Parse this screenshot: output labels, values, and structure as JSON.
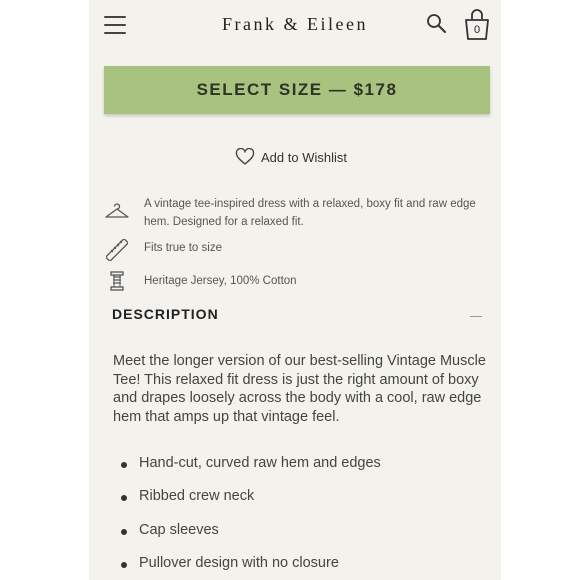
{
  "header": {
    "brand": "Frank & Eileen",
    "cart_count": "0"
  },
  "purchase": {
    "select_size_label": "SELECT SIZE — $178",
    "wishlist_label": "Add to Wishlist"
  },
  "features": [
    {
      "icon": "hanger-icon",
      "text": "A vintage tee-inspired dress with a relaxed, boxy fit and raw edge hem. Designed for a relaxed fit."
    },
    {
      "icon": "ruler-icon",
      "text": "Fits true to size"
    },
    {
      "icon": "thread-spool-icon",
      "text": "Heritage Jersey, 100% Cotton"
    }
  ],
  "description": {
    "title": "DESCRIPTION",
    "body": "Meet the longer version of our best-selling Vintage Muscle Tee! This relaxed fit dress is just the right amount of boxy and drapes loosely across the body with a cool, raw edge hem that amps up that vintage feel.",
    "bullets": [
      "Hand-cut, curved raw hem and edges",
      "Ribbed crew neck",
      "Cap sleeves",
      "Pullover design with no closure"
    ]
  },
  "colors": {
    "background": "#f3f2ed",
    "cta": "#a8c280"
  }
}
